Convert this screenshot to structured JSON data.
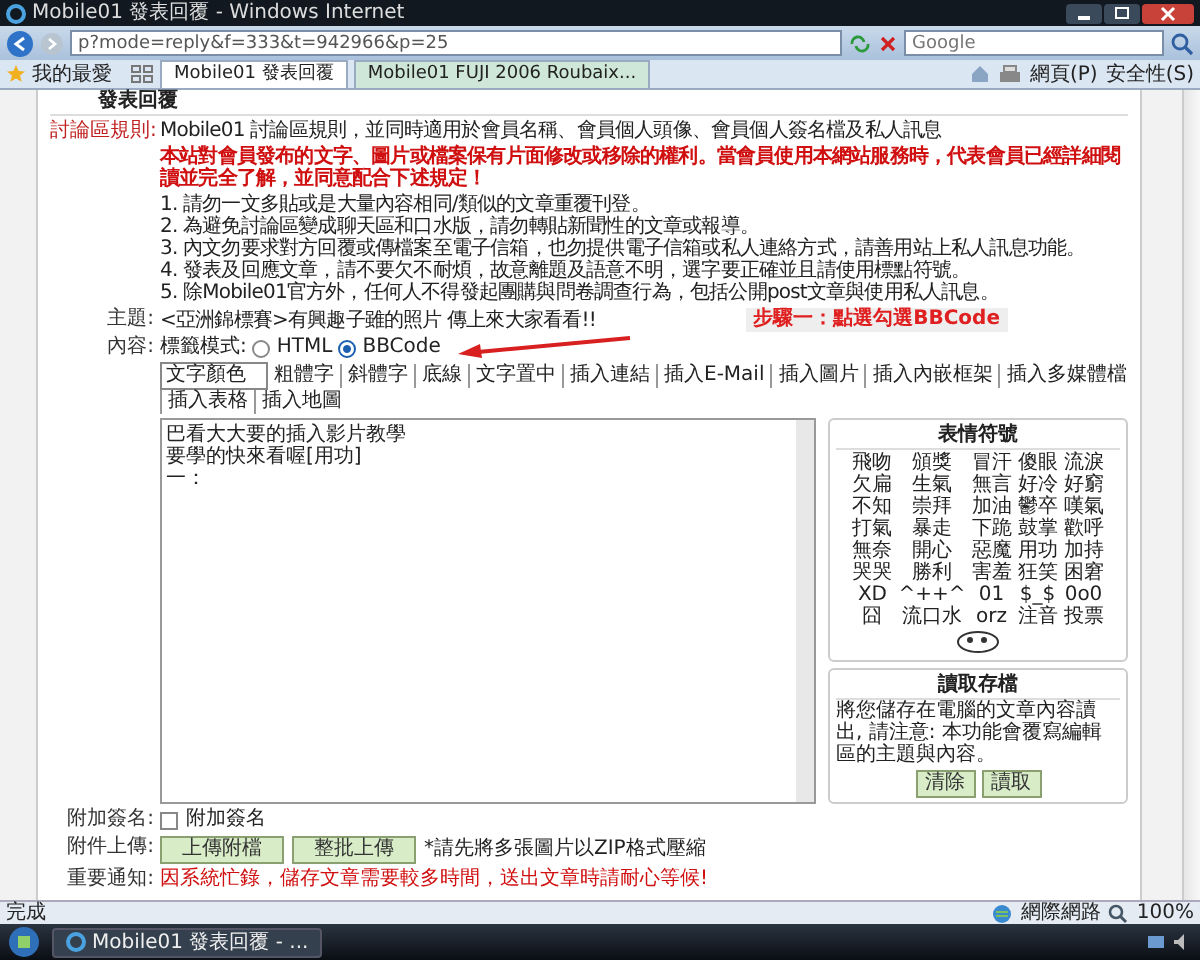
{
  "window": {
    "title": "Mobile01 發表回覆 - Windows Internet"
  },
  "address_bar": {
    "url": "p?mode=reply&f=333&t=942966&p=25"
  },
  "search": {
    "placeholder": "Google"
  },
  "favorites": {
    "label": "我的最愛"
  },
  "tabs": [
    {
      "label": "Mobile01 發表回覆",
      "selected": true
    },
    {
      "label": "Mobile01 FUJI 2006 Roubaix...",
      "selected": false
    }
  ],
  "command_bar": [
    {
      "label": "網頁(P)"
    },
    {
      "label": "安全性(S)"
    }
  ],
  "form": {
    "title": "發表回覆",
    "rules": {
      "label": "討論區規則:",
      "intro": "Mobile01 討論區規則，並同時適用於會員名稱、會員個人頭像、會員個人簽名檔及私人訊息",
      "warning": "本站對會員發布的文字、圖片或檔案保有片面修改或移除的權利。當會員使用本網站服務時，代表會員已經詳細閱讀並完全了解，並同意配合下述規定！",
      "items": [
        "1. 請勿一文多貼或是大量內容相同/類似的文章重覆刊登。",
        "2. 為避免討論區變成聊天區和口水版，請勿轉貼新聞性的文章或報導。",
        "3. 內文勿要求對方回覆或傳檔案至電子信箱，也勿提供電子信箱或私人連絡方式，請善用站上私人訊息功能。",
        "4. 發表及回應文章，請不要欠不耐煩，故意離題及語意不明，選字要正確並且請使用標點符號。",
        "5. 除Mobile01官方外，任何人不得發起團購與問卷調查行為，包括公開post文章與使用私人訊息。"
      ]
    },
    "annotation": "步驟一：點選勾選BBCode",
    "subject": {
      "label": "主題:",
      "value": "<亞洲錦標賽>有興趣子雖的照片 傳上來大家看看!!"
    },
    "content": {
      "label": "內容:",
      "mode_label": "標籤模式:",
      "modes": [
        {
          "label": "HTML",
          "selected": false
        },
        {
          "label": "BBCode",
          "selected": true
        }
      ],
      "color_select": "文字顏色",
      "tools": [
        "粗體字",
        "斜體字",
        "底線",
        "文字置中",
        "插入連結",
        "插入E-Mail",
        "插入圖片",
        "插入內嵌框架",
        "插入多媒體檔",
        "插入表格",
        "插入地圖"
      ],
      "lines": [
        "巴看大大要的插入影片教學",
        "要學的快來看喔[用功]",
        "一："
      ]
    },
    "emoticons": {
      "title": "表情符號",
      "items": [
        "飛吻",
        "頒獎",
        "冒汗",
        "傻眼",
        "流淚",
        "欠扁",
        "生氣",
        "無言",
        "好冷",
        "好窮",
        "不知",
        "崇拜",
        "加油",
        "鬱卒",
        "嘆氣",
        "打氣",
        "暴走",
        "下跪",
        "鼓掌",
        "歡呼",
        "無奈",
        "開心",
        "惡魔",
        "用功",
        "加持",
        "哭哭",
        "勝利",
        "害羞",
        "狂笑",
        "困窘",
        "XD",
        "^++^",
        "01",
        "$_$",
        "0o0",
        "囧",
        "流口水",
        "orz",
        "注音",
        "投票"
      ]
    },
    "load_draft": {
      "title": "讀取存檔",
      "description": "將您儲存在電腦的文章內容讀出, 請注意: 本功能會覆寫編輯區的主題與內容。",
      "buttons": [
        "清除",
        "讀取"
      ]
    },
    "signature": {
      "label": "附加簽名:",
      "option": "附加簽名",
      "checked": false
    },
    "attachments": {
      "label": "附件上傳:",
      "buttons": [
        "上傳附檔",
        "整批上傳"
      ],
      "note": "*請先將多張圖片以ZIP格式壓縮"
    },
    "notice": {
      "label": "重要通知:",
      "text": "因系統忙錄，儲存文章需要較多時間，送出文章時請耐心等候!"
    }
  },
  "status_bar": {
    "text": "完成",
    "zone": "網際網路",
    "zoom": "100%"
  },
  "taskbar": {
    "items": [
      {
        "label": "Mobile01 發表回覆 - ..."
      }
    ]
  }
}
